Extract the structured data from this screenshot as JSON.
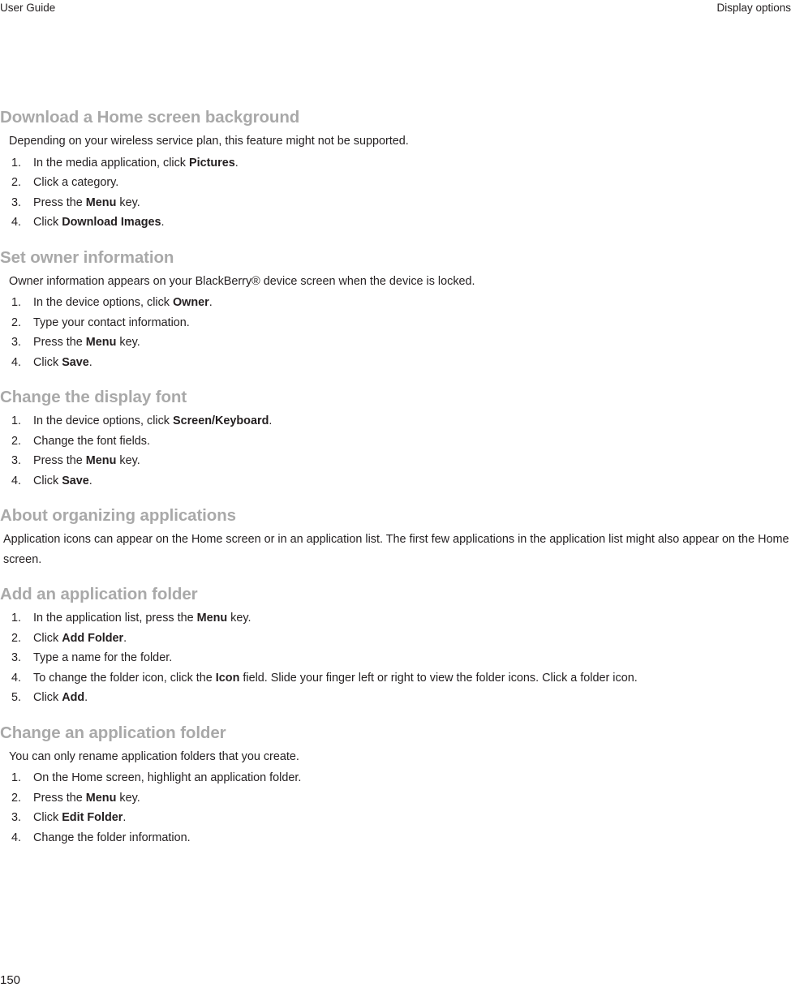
{
  "header": {
    "left": "User Guide",
    "right": "Display options"
  },
  "footer": {
    "page_number": "150"
  },
  "sections": [
    {
      "title": "Download a Home screen background",
      "intro": "Depending on your wireless service plan, this feature might not be supported.",
      "steps": [
        {
          "num": "1.",
          "html": "In the media application, click <b>Pictures</b>."
        },
        {
          "num": "2.",
          "html": "Click a category."
        },
        {
          "num": "3.",
          "html": "Press the <b>Menu</b> key."
        },
        {
          "num": "4.",
          "html": "Click <b>Download Images</b>."
        }
      ]
    },
    {
      "title": "Set owner information",
      "intro": "Owner information appears on your BlackBerry® device screen when the device is locked.",
      "steps": [
        {
          "num": "1.",
          "html": "In the device options, click <b>Owner</b>."
        },
        {
          "num": "2.",
          "html": "Type your contact information."
        },
        {
          "num": "3.",
          "html": "Press the <b>Menu</b> key."
        },
        {
          "num": "4.",
          "html": "Click <b>Save</b>."
        }
      ]
    },
    {
      "title": "Change the display font",
      "intro": "",
      "steps": [
        {
          "num": "1.",
          "html": "In the device options, click <b>Screen/Keyboard</b>."
        },
        {
          "num": "2.",
          "html": "Change the font fields."
        },
        {
          "num": "3.",
          "html": "Press the <b>Menu</b> key."
        },
        {
          "num": "4.",
          "html": "Click <b>Save</b>."
        }
      ]
    },
    {
      "title": "About organizing applications",
      "paragraph": "Application icons can appear on the Home screen or in an application list. The first few applications in the application list might also appear on the Home screen.",
      "steps": []
    },
    {
      "title": "Add an application folder",
      "intro": "",
      "steps": [
        {
          "num": "1.",
          "html": "In the application list, press the <b>Menu</b> key."
        },
        {
          "num": "2.",
          "html": "Click <b>Add Folder</b>."
        },
        {
          "num": "3.",
          "html": "Type a name for the folder."
        },
        {
          "num": "4.",
          "html": "To change the folder icon, click the <b>Icon</b> field. Slide your finger left or right to view the folder icons. Click a folder icon."
        },
        {
          "num": "5.",
          "html": "Click <b>Add</b>."
        }
      ]
    },
    {
      "title": "Change an application folder",
      "intro": "You can only rename application folders that you create.",
      "steps": [
        {
          "num": "1.",
          "html": "On the Home screen, highlight an application folder."
        },
        {
          "num": "2.",
          "html": "Press the <b>Menu</b> key."
        },
        {
          "num": "3.",
          "html": "Click <b>Edit Folder</b>."
        },
        {
          "num": "4.",
          "html": "Change the folder information."
        }
      ]
    }
  ]
}
